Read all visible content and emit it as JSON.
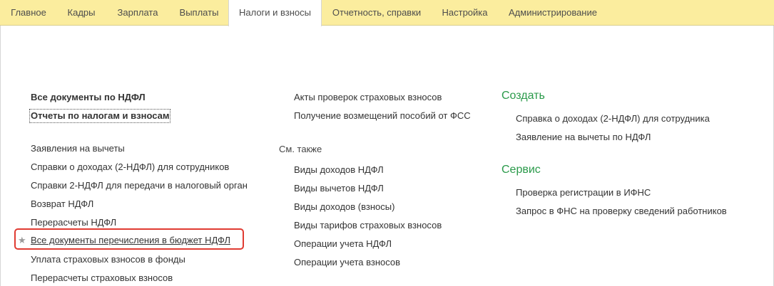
{
  "tabs": [
    {
      "label": "Главное"
    },
    {
      "label": "Кадры"
    },
    {
      "label": "Зарплата"
    },
    {
      "label": "Выплаты"
    },
    {
      "label": "Налоги и взносы"
    },
    {
      "label": "Отчетность, справки"
    },
    {
      "label": "Настройка"
    },
    {
      "label": "Администрирование"
    }
  ],
  "active_tab": "Налоги и взносы",
  "col1": {
    "bold_links": [
      "Все документы по НДФЛ",
      "Отчеты по налогам и взносам"
    ],
    "links": [
      "Заявления на вычеты",
      "Справки о доходах (2-НДФЛ) для сотрудников",
      "Справки 2-НДФЛ для передачи в налоговый орган",
      "Возврат НДФЛ",
      "Перерасчеты НДФЛ",
      "Все документы перечисления в бюджет НДФЛ",
      "Уплата страховых взносов в фонды",
      "Перерасчеты страховых взносов"
    ]
  },
  "col2": {
    "links_top": [
      "Акты проверок страховых взносов",
      "Получение возмещений пособий от ФСС"
    ],
    "see_also_label": "См. также",
    "see_also": [
      "Виды доходов НДФЛ",
      "Виды вычетов НДФЛ",
      "Виды доходов (взносы)",
      "Виды тарифов страховых взносов",
      "Операции учета НДФЛ",
      "Операции учета взносов"
    ]
  },
  "col3": {
    "create_title": "Создать",
    "create_links": [
      "Справка о доходах (2-НДФЛ) для сотрудника",
      "Заявление на вычеты по НДФЛ"
    ],
    "service_title": "Сервис",
    "service_links": [
      "Проверка регистрации в ИФНС",
      "Запрос в ФНС на проверку сведений работников"
    ]
  },
  "colors": {
    "topbar": "#fbed9e",
    "section_title": "#2a9a4a",
    "highlight_border": "#e03b32"
  },
  "icons": {
    "favorite": "star-icon"
  }
}
